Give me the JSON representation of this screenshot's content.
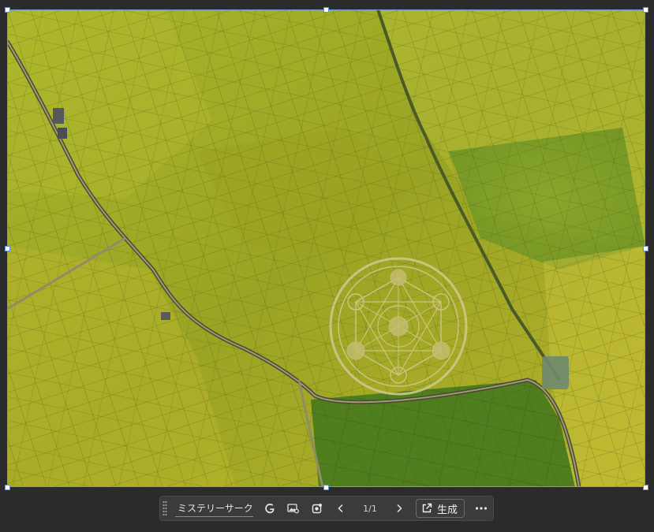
{
  "image": {
    "subject": "aerial-photo-rice-fields-with-crop-circle"
  },
  "toolbar": {
    "name_value": "ミステリーサークル",
    "page_counter": "1/1",
    "generate_label": "生成",
    "icons": {
      "grip": "drag-handle-icon",
      "google": "google-lens-icon",
      "image_search": "visual-search-icon",
      "puzzle": "extension-icon",
      "prev": "chevron-left-icon",
      "next": "chevron-right-icon",
      "generate": "open-in-new-icon",
      "more": "more-horizontal-icon"
    }
  },
  "colors": {
    "background": "#2b2b2b",
    "toolbar_bg": "#3b3b3b",
    "selection": "#6e9bd6"
  }
}
